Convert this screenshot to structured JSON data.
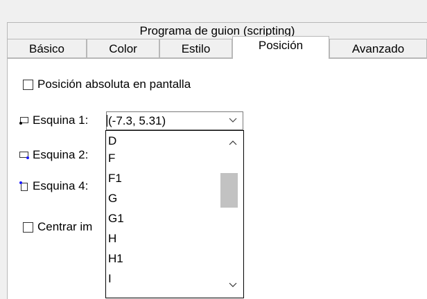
{
  "header_tab": "Programa de guion (scripting)",
  "tabs": [
    {
      "label": "Básico"
    },
    {
      "label": "Color"
    },
    {
      "label": "Estilo"
    },
    {
      "label": "Posición",
      "active": true
    },
    {
      "label": "Avanzado"
    }
  ],
  "absolute_position": {
    "label": "Posición absoluta en pantalla",
    "checked": false
  },
  "corners": {
    "corner1": {
      "label": "Esquina 1:",
      "value": "(-7.3, 5.31)"
    },
    "corner2": {
      "label": "Esquina 2:"
    },
    "corner4": {
      "label": "Esquina 4:"
    }
  },
  "center_image": {
    "label_visible": "Centrar im",
    "checked": false
  },
  "dropdown_items": [
    "D",
    "F",
    "F1",
    "G",
    "G1",
    "H",
    "H1",
    "I"
  ]
}
